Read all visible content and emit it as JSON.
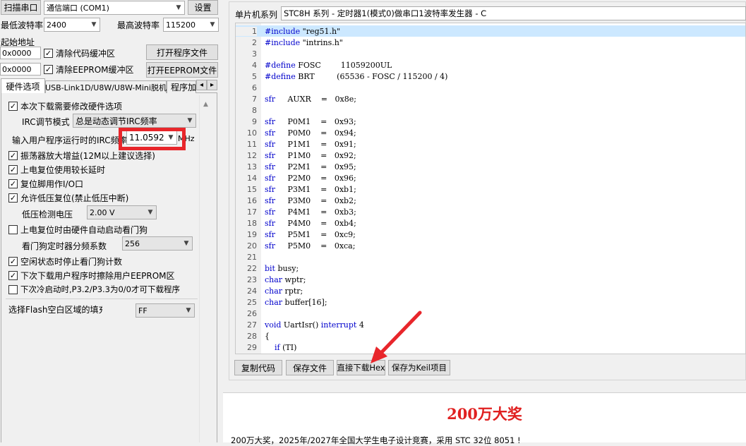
{
  "top": {
    "scan_port_button": "扫描串口",
    "port_value": "通信端口 (COM1)",
    "settings_button": "设置",
    "min_baud_label": "最低波特率",
    "min_baud_value": "2400",
    "max_baud_label": "最高波特率",
    "max_baud_value": "115200",
    "start_addr_label": "起始地址",
    "addr1_value": "0x0000",
    "clear_code_label": "清除代码缓冲区",
    "open_program_button": "打开程序文件",
    "addr2_value": "0x0000",
    "clear_eeprom_label": "清除EEPROM缓冲区",
    "open_eeprom_button": "打开EEPROM文件"
  },
  "tabs": [
    {
      "label": "硬件选项"
    },
    {
      "label": "USB-Link1D/U8W/U8W-Mini脱机"
    },
    {
      "label": "程序加"
    }
  ],
  "tab_nav": {
    "prev": "◂",
    "next": "▸"
  },
  "options": {
    "modify_hw_label": "本次下载需要修改硬件选项",
    "irc_mode_label": "IRC调节模式",
    "irc_mode_value": "总是动态调节IRC频率",
    "irc_freq_label": "输入用户程序运行时的IRC频率",
    "irc_freq_value": "11.0592",
    "irc_freq_unit": "MHz",
    "osc_gain_label": "振荡器放大增益(12M以上建议选择)",
    "power_reset_delay_label": "上电复位使用较长延时",
    "reset_pin_io_label": "复位脚用作I/O口",
    "low_voltage_reset_label": "允许低压复位(禁止低压中断)",
    "low_voltage_detect_label": "低压检测电压",
    "low_voltage_value": "2.00 V",
    "watchdog_auto_label": "上电复位时由硬件自动启动看门狗",
    "watchdog_div_label": "看门狗定时器分频系数",
    "watchdog_div_value": "256",
    "idle_stop_wdt_label": "空闲状态时停止看门狗计数",
    "erase_eeprom_label": "下次下载用户程序时擦除用户EEPROM区",
    "cold_boot_label": "下次冷启动时,P3.2/P3.3为0/0才可下载程序",
    "flash_fill_label": "选择Flash空白区域的填充",
    "flash_fill_value": "FF"
  },
  "right": {
    "series_label": "单片机系列",
    "series_value": "STC8H 系列 - 定时器1(模式0)做串口1波特率发生器 - C",
    "code_lines": [
      "#include \"reg51.h\"",
      "#include \"intrins.h\"",
      "",
      "#define FOSC        11059200UL",
      "#define BRT         (65536 - FOSC / 115200 / 4)",
      "",
      "sfr     AUXR    =   0x8e;",
      "",
      "sfr     P0M1    =   0x93;",
      "sfr     P0M0    =   0x94;",
      "sfr     P1M1    =   0x91;",
      "sfr     P1M0    =   0x92;",
      "sfr     P2M1    =   0x95;",
      "sfr     P2M0    =   0x96;",
      "sfr     P3M1    =   0xb1;",
      "sfr     P3M0    =   0xb2;",
      "sfr     P4M1    =   0xb3;",
      "sfr     P4M0    =   0xb4;",
      "sfr     P5M1    =   0xc9;",
      "sfr     P5M0    =   0xca;",
      "",
      "bit busy;",
      "char wptr;",
      "char rptr;",
      "char buffer[16];",
      "",
      "void UartIsr() interrupt 4",
      "{",
      "    if (TI)"
    ],
    "copy_code_button": "复制代码",
    "save_file_button": "保存文件",
    "direct_download_button": "直接下载Hex",
    "save_keil_button": "保存为Keil项目"
  },
  "news": {
    "title": "200万大奖",
    "body": "200万大奖，2025年/2027年全国大学生电子设计竞赛，采用 STC 32位 8051 !",
    "title_color": "#e02020"
  },
  "highlight_color": "#e8262b"
}
